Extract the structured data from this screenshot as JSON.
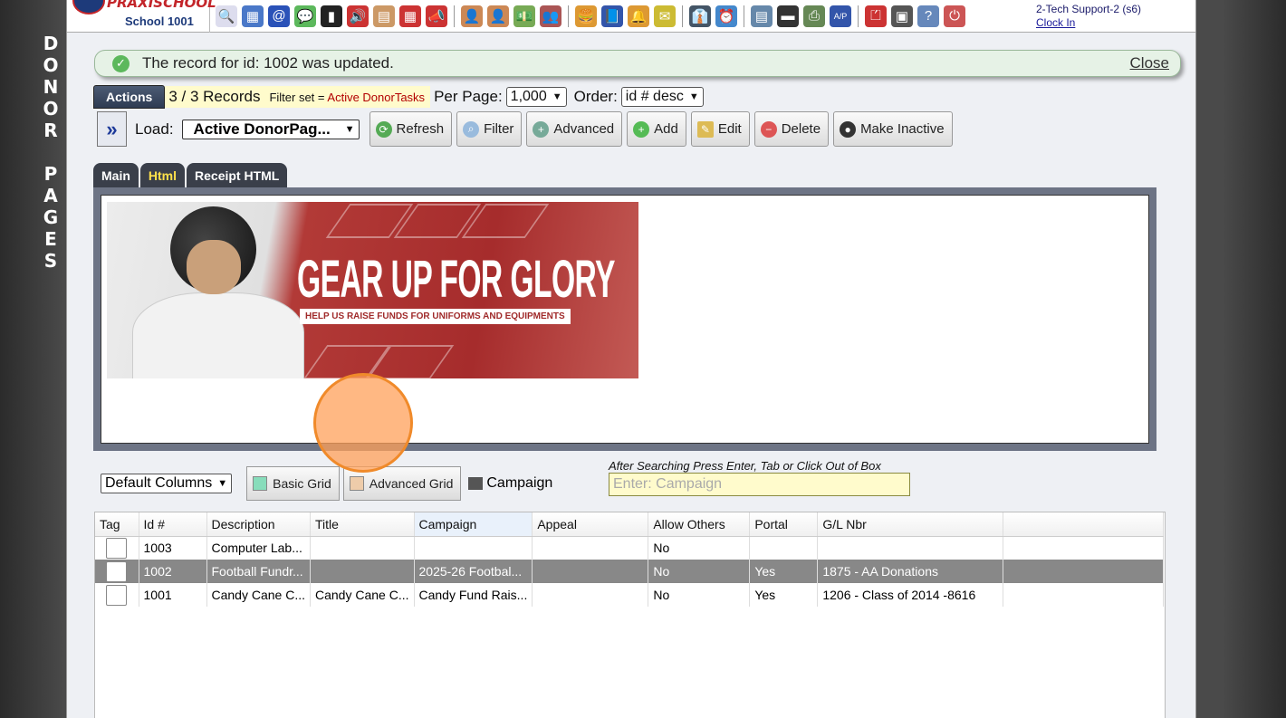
{
  "side_title": [
    "D",
    "O",
    "N",
    "O",
    "R",
    "",
    "P",
    "A",
    "G",
    "E",
    "S"
  ],
  "logo": {
    "brand": "PRAXISCHOOL",
    "school": "School 1001"
  },
  "toolbar_icons": [
    {
      "name": "search-icon",
      "glyph": "🔍",
      "color": "#dde"
    },
    {
      "name": "calendar-grid-icon",
      "glyph": "▦",
      "color": "#4a78c8"
    },
    {
      "name": "at-email-icon",
      "glyph": "@",
      "color": "#2a52b8"
    },
    {
      "name": "chat-icon",
      "glyph": "💬",
      "color": "#5cb85c"
    },
    {
      "name": "phone-icon",
      "glyph": "▮",
      "color": "#222"
    },
    {
      "name": "speaker-icon",
      "glyph": "🔊",
      "color": "#c33"
    },
    {
      "name": "form-icon",
      "glyph": "▤",
      "color": "#c96"
    },
    {
      "name": "calendar-icon",
      "glyph": "▦",
      "color": "#c33"
    },
    {
      "name": "megaphone-icon",
      "glyph": "📣",
      "color": "#c33"
    },
    {
      "name": "sep",
      "glyph": "",
      "color": ""
    },
    {
      "name": "add-person-icon",
      "glyph": "👤",
      "color": "#c85"
    },
    {
      "name": "person-icon",
      "glyph": "👤",
      "color": "#c85"
    },
    {
      "name": "money-icon",
      "glyph": "💵",
      "color": "#7a5"
    },
    {
      "name": "family-icon",
      "glyph": "👥",
      "color": "#a55"
    },
    {
      "name": "sep",
      "glyph": "",
      "color": ""
    },
    {
      "name": "lunch-icon",
      "glyph": "🍔",
      "color": "#d93"
    },
    {
      "name": "book-icon",
      "glyph": "📘",
      "color": "#35a"
    },
    {
      "name": "bell-icon",
      "glyph": "🔔",
      "color": "#d93"
    },
    {
      "name": "note-icon",
      "glyph": "✉",
      "color": "#cb3"
    },
    {
      "name": "sep",
      "glyph": "",
      "color": ""
    },
    {
      "name": "staff-icon",
      "glyph": "👔",
      "color": "#456"
    },
    {
      "name": "clock-icon",
      "glyph": "⏰",
      "color": "#48c"
    },
    {
      "name": "sep",
      "glyph": "",
      "color": ""
    },
    {
      "name": "report-icon",
      "glyph": "▤",
      "color": "#68a"
    },
    {
      "name": "card-icon",
      "glyph": "▬",
      "color": "#333"
    },
    {
      "name": "printer-icon",
      "glyph": "⎙",
      "color": "#685"
    },
    {
      "name": "ap-icon",
      "glyph": "A/P",
      "color": "#35a"
    },
    {
      "name": "sep",
      "glyph": "",
      "color": ""
    },
    {
      "name": "pdf-icon",
      "glyph": "⏍",
      "color": "#c33"
    },
    {
      "name": "cash-register-icon",
      "glyph": "▣",
      "color": "#555"
    },
    {
      "name": "help-icon",
      "glyph": "?",
      "color": "#68b"
    },
    {
      "name": "power-icon",
      "glyph": "⏻",
      "color": "#c55"
    }
  ],
  "user": {
    "name": "2-Tech Support-2 (s6)",
    "clock_in": "Clock In"
  },
  "notice": {
    "message": "The record for id: 1002 was updated.",
    "close": "Close"
  },
  "actions": {
    "tab": "Actions",
    "records": "3 / 3 Records",
    "filter_prefix": "Filter set = ",
    "filter_value": "Active DonorTasks",
    "per_page_label": "Per Page:",
    "per_page_value": "1,000",
    "order_label": "Order:",
    "order_value": "id # desc"
  },
  "toolbar2": {
    "load_label": "Load:",
    "load_value": "Active DonorPag...",
    "refresh": "Refresh",
    "filter": "Filter",
    "advanced": "Advanced",
    "add": "Add",
    "edit": "Edit",
    "delete": "Delete",
    "make_inactive": "Make Inactive"
  },
  "tabs": [
    "Main",
    "Html",
    "Receipt HTML"
  ],
  "active_tab": "Html",
  "banner": {
    "headline": "GEAR UP FOR GLORY",
    "subline": "HELP US RAISE FUNDS FOR UNIFORMS AND EQUIPMENTS"
  },
  "grid_controls": {
    "columns": "Default Columns",
    "basic_grid": "Basic Grid",
    "advanced_grid": "Advanced Grid",
    "campaign_label": "Campaign",
    "hint": "After Searching Press Enter, Tab or Click Out of Box",
    "placeholder": "Enter: Campaign"
  },
  "grid": {
    "columns": [
      "Tag",
      "Id #",
      "Description",
      "Title",
      "Campaign",
      "Appeal",
      "Allow Others",
      "Portal",
      "G/L Nbr"
    ],
    "rows": [
      [
        "",
        "1003",
        "Computer Lab...",
        "",
        "",
        "",
        "No",
        "",
        ""
      ],
      [
        "",
        "1002",
        "Football Fundr...",
        "",
        "2025-26 Footbal...",
        "",
        "No",
        "Yes",
        "1875 - AA Donations"
      ],
      [
        "",
        "1001",
        "Candy Cane C...",
        "Candy Cane C...",
        "Candy Fund Rais...",
        "",
        "No",
        "Yes",
        "1206 - Class of 2014 -8616"
      ]
    ],
    "selected_row": 1
  }
}
